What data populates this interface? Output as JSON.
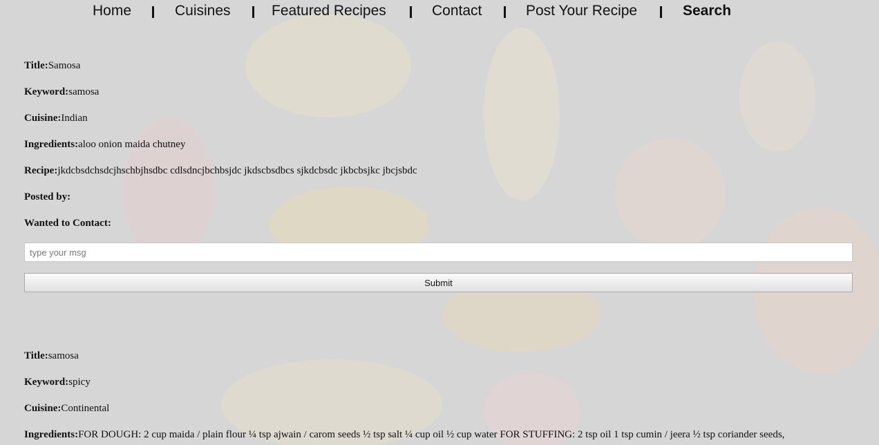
{
  "nav": {
    "items": [
      "Home",
      "Cuisines",
      "Featured Recipes",
      "Contact",
      "Post Your Recipe",
      "Search"
    ],
    "active": "Search"
  },
  "labels": {
    "title": "Title:",
    "keyword": "Keyword:",
    "cuisine": "Cuisine:",
    "ingredients": "Ingredients:",
    "recipe": "Recipe:",
    "posted_by": "Posted by:",
    "wanted_to_contact": "Wanted to Contact:"
  },
  "recipes": [
    {
      "title": "Samosa",
      "keyword": "samosa",
      "cuisine": "Indian",
      "ingredients": "aloo onion maida chutney",
      "recipe": "jkdcbsdchsdcjhschbjhsdbc cdlsdncjbchbsjdc jkdscbsdbcs sjkdcbsdc jkbcbsjkc jbcjsbdc",
      "posted_by": "",
      "contact_form": {
        "placeholder": "type your msg",
        "value": "",
        "submit_label": "Submit"
      }
    },
    {
      "title": "samosa",
      "keyword": "spicy",
      "cuisine": "Continental",
      "ingredients": "FOR DOUGH: 2 cup maida / plain flour ¼ tsp ajwain / carom seeds ½ tsp salt ¼ cup oil ½ cup water FOR STUFFING: 2 tsp oil 1 tsp cumin / jeera ½ tsp coriander seeds,"
    }
  ],
  "colors": {
    "background": "#d6d6d6",
    "text": "#111111"
  }
}
